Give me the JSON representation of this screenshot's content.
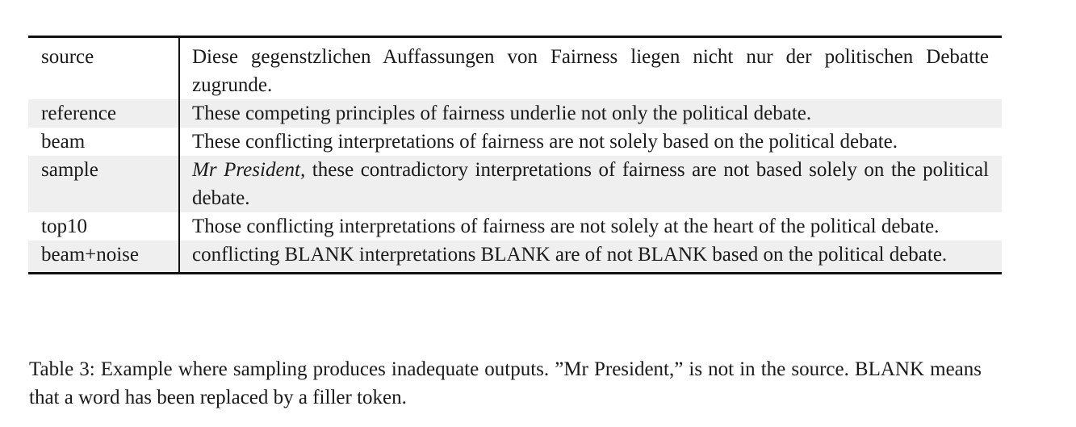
{
  "table": {
    "rows": [
      {
        "label": "source",
        "emphasis": "",
        "text": "Diese gegenstzlichen Auffassungen von Fairness liegen nicht nur der politischen Debatte zugrunde.",
        "shaded": false
      },
      {
        "label": "reference",
        "emphasis": "",
        "text": "These competing principles of fairness underlie not only the political debate.",
        "shaded": true
      },
      {
        "label": "beam",
        "emphasis": "",
        "text": "These conflicting interpretations of fairness are not solely based on the political debate.",
        "shaded": false
      },
      {
        "label": "sample",
        "emphasis": "Mr President,",
        "text": " these contradictory interpretations of fairness are not based solely on the political debate.",
        "shaded": true
      },
      {
        "label": "top10",
        "emphasis": "",
        "text": "Those conflicting interpretations of fairness are not solely at the heart of the political debate.",
        "shaded": false
      },
      {
        "label": "beam+noise",
        "emphasis": "",
        "text": "conflicting BLANK interpretations BLANK are of not BLANK based on the political debate.",
        "shaded": true
      }
    ]
  },
  "caption": {
    "text": "Table 3: Example where sampling produces inadequate outputs.  ”Mr President,” is not in the source. BLANK means that a word has been replaced by a filler token."
  }
}
